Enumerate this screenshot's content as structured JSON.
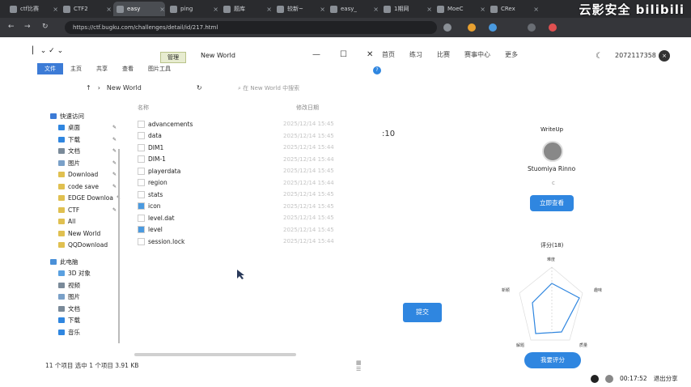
{
  "browser": {
    "tabs": [
      {
        "label": "ctf比赛"
      },
      {
        "label": "CTF2"
      },
      {
        "label": "easy"
      },
      {
        "label": "ping"
      },
      {
        "label": "题库"
      },
      {
        "label": "较新~"
      },
      {
        "label": "easy_"
      },
      {
        "label": "1期网"
      },
      {
        "label": "MoeC"
      },
      {
        "label": "CRex"
      }
    ],
    "url": "https://ctf.bugku.com/challenges/detail/id/217.html",
    "watermark": "云影安全 bilibili"
  },
  "explorer": {
    "title": "New World",
    "manage_label": "管理",
    "ribbon_tabs": [
      "文件",
      "主页",
      "共享",
      "查看",
      "图片工具"
    ],
    "path": "New World",
    "search_placeholder": "在 New World 中搜索",
    "controls": {
      "min": "—",
      "max": "☐",
      "close": "✕"
    },
    "sidebar": {
      "quick_access": "快速访问",
      "items": [
        {
          "label": "桌面",
          "pinned": true,
          "color": "#2f86e0"
        },
        {
          "label": "下载",
          "pinned": true,
          "color": "#2f86e0"
        },
        {
          "label": "文档",
          "pinned": true,
          "color": "#7a8a99"
        },
        {
          "label": "图片",
          "pinned": true,
          "color": "#7aa0c8"
        },
        {
          "label": "Download",
          "pinned": true,
          "color": "#e0c050"
        },
        {
          "label": "code save",
          "pinned": true,
          "color": "#e0c050"
        },
        {
          "label": "EDGE Downloa",
          "pinned": true,
          "color": "#e0c050"
        },
        {
          "label": "CTF",
          "pinned": true,
          "color": "#e0c050"
        },
        {
          "label": "All",
          "pinned": false,
          "color": "#e0c050"
        },
        {
          "label": "New World",
          "pinned": false,
          "color": "#e0c050"
        },
        {
          "label": "QQDownload",
          "pinned": false,
          "color": "#e0c050"
        }
      ],
      "this_pc": "此电脑",
      "pc_items": [
        {
          "label": "3D 对象",
          "color": "#5aa0e0"
        },
        {
          "label": "视频",
          "color": "#7a8a99"
        },
        {
          "label": "图片",
          "color": "#7aa0c8"
        },
        {
          "label": "文档",
          "color": "#7a8a99"
        },
        {
          "label": "下载",
          "color": "#2f86e0"
        },
        {
          "label": "音乐",
          "color": "#2f86e0"
        }
      ]
    },
    "columns": {
      "name": "名称",
      "date": "修改日期"
    },
    "files": [
      {
        "name": "advancements",
        "date": "2025/12/14 15:45",
        "kind": "folder"
      },
      {
        "name": "data",
        "date": "2025/12/14 15:45",
        "kind": "folder"
      },
      {
        "name": "DIM1",
        "date": "2025/12/14 15:44",
        "kind": "folder"
      },
      {
        "name": "DIM-1",
        "date": "2025/12/14 15:44",
        "kind": "folder"
      },
      {
        "name": "playerdata",
        "date": "2025/12/14 15:45",
        "kind": "folder"
      },
      {
        "name": "region",
        "date": "2025/12/14 15:44",
        "kind": "folder"
      },
      {
        "name": "stats",
        "date": "2025/12/14 15:45",
        "kind": "folder"
      },
      {
        "name": "icon",
        "date": "2025/12/14 15:45",
        "kind": "image"
      },
      {
        "name": "level.dat",
        "date": "2025/12/14 15:45",
        "kind": "file"
      },
      {
        "name": "level",
        "date": "2025/12/14 15:45",
        "kind": "doc"
      },
      {
        "name": "session.lock",
        "date": "2025/12/14 15:44",
        "kind": "file"
      }
    ],
    "status": "11 个项目    选中 1 个项目  3.91 KB"
  },
  "site": {
    "nav": [
      "首页",
      "练习",
      "比赛",
      "赛事中心",
      "更多"
    ],
    "user_id": "2072117358",
    "timer": ":10",
    "writeup_label": "WriteUp",
    "author": "Stuomiya Rinno",
    "author_sub": "c",
    "view_button": "立即查看",
    "score_title": "评分(18)",
    "radar_labels": [
      "难度",
      "趣味",
      "质量",
      "解题",
      "新颖"
    ],
    "rate_button": "我要评分",
    "submit_button": "提交"
  },
  "player": {
    "time": "00:17:52",
    "exit": "退出分享"
  }
}
